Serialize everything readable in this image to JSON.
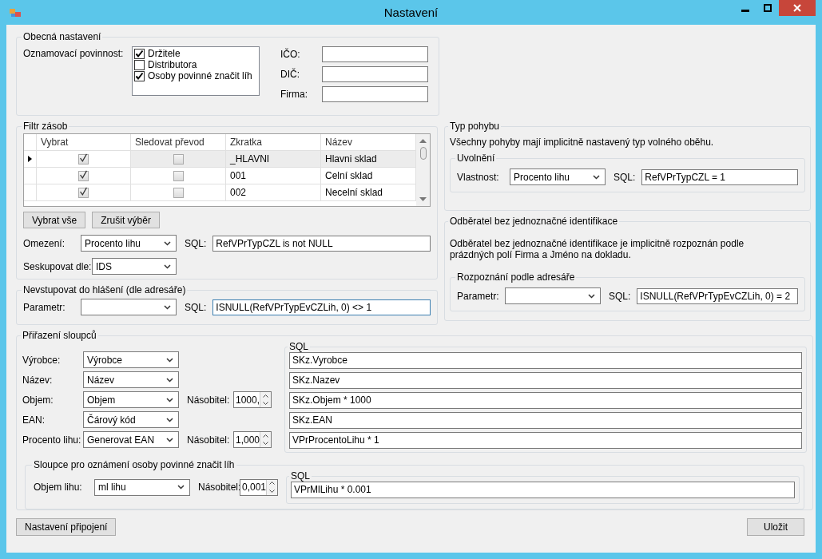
{
  "window": {
    "title": "Nastavení"
  },
  "general": {
    "title": "Obecná nastavení",
    "notification_label": "Oznamovací povinnost:",
    "notification_options": [
      {
        "label": "Držitele",
        "checked": true
      },
      {
        "label": "Distributora",
        "checked": false
      },
      {
        "label": "Osoby povinné značit líh",
        "checked": true
      }
    ],
    "fields": [
      {
        "label": "IČO:"
      },
      {
        "label": "DIČ:"
      },
      {
        "label": "Firma:"
      }
    ]
  },
  "stock_filter": {
    "title": "Filtr zásob",
    "columns": [
      "Vybrat",
      "Sledovat převod",
      "Zkratka",
      "Název"
    ],
    "rows": [
      {
        "selected": true,
        "select": true,
        "track": false,
        "code": "_HLAVNI",
        "name": "Hlavni sklad"
      },
      {
        "selected": false,
        "select": true,
        "track": false,
        "code": "001",
        "name": "Celní sklad"
      },
      {
        "selected": false,
        "select": true,
        "track": false,
        "code": "002",
        "name": "Necelní sklad"
      }
    ],
    "buttons": [
      "Vybrat vše",
      "Zrušit výběr"
    ],
    "restriction": {
      "label": "Omezení:",
      "value": "Procento lihu",
      "sql_label": "SQL:",
      "sql": "RefVPrTypCZL is not NULL"
    },
    "group_by": {
      "label": "Seskupovat dle:",
      "value": "IDS"
    }
  },
  "exclude": {
    "title": "Nevstupovat do hlášení (dle adresáře)",
    "param_label": "Parametr:",
    "sql_label": "SQL:",
    "sql": "ISNULL(RefVPrTypEvCZLih, 0) <> 1",
    "focused": true
  },
  "movement_type": {
    "title": "Typ pohybu",
    "description": "Všechny pohyby mají implicitně nastavený typ volného oběhu.",
    "release": {
      "title": "Uvolnění",
      "property_label": "Vlastnost:",
      "property": "Procento lihu",
      "sql_label": "SQL:",
      "sql": "RefVPrTypCZL = 1"
    }
  },
  "unidentified_customer": {
    "title": "Odběratel bez jednoznačné identifikace",
    "description": "Odběratel bez jednoznačné identifikace je implicitně rozpoznán podle prázdných polí Firma a Jméno na dokladu.",
    "recognition": {
      "title": "Rozpoznání podle adresáře",
      "param_label": "Parametr:",
      "sql_label": "SQL:",
      "sql": "ISNULL(RefVPrTypEvCZLih, 0) = 2"
    }
  },
  "column_mapping": {
    "title": "Přiřazení sloupců",
    "sql_title": "SQL",
    "rows": [
      {
        "label": "Výrobce:",
        "value": "Výrobce",
        "sql": "SKz.Vyrobce"
      },
      {
        "label": "Název:",
        "value": "Název",
        "sql": "SKz.Nazev"
      },
      {
        "label": "Objem:",
        "value": "Objem",
        "multiplier_label": "Násobitel:",
        "multiplier": "1000,",
        "sql": "SKz.Objem * 1000"
      },
      {
        "label": "EAN:",
        "value": "Čárový kód",
        "sql": "SKz.EAN"
      },
      {
        "label": "Procento lihu:",
        "value": "Generovat EAN",
        "multiplier_label": "Násobitel:",
        "multiplier": "1,000",
        "sql": "VPrProcentoLihu * 1"
      }
    ],
    "marking": {
      "title": "Sloupce pro oznámení osoby povinné značit líh",
      "label": "Objem lihu:",
      "value": "ml lihu",
      "multiplier_label": "Násobitel:",
      "multiplier": "0,001",
      "sql_title": "SQL",
      "sql": "VPrMlLihu * 0.001"
    }
  },
  "footer": {
    "left_button": "Nastavení připojení",
    "right_button": "Uložit"
  }
}
